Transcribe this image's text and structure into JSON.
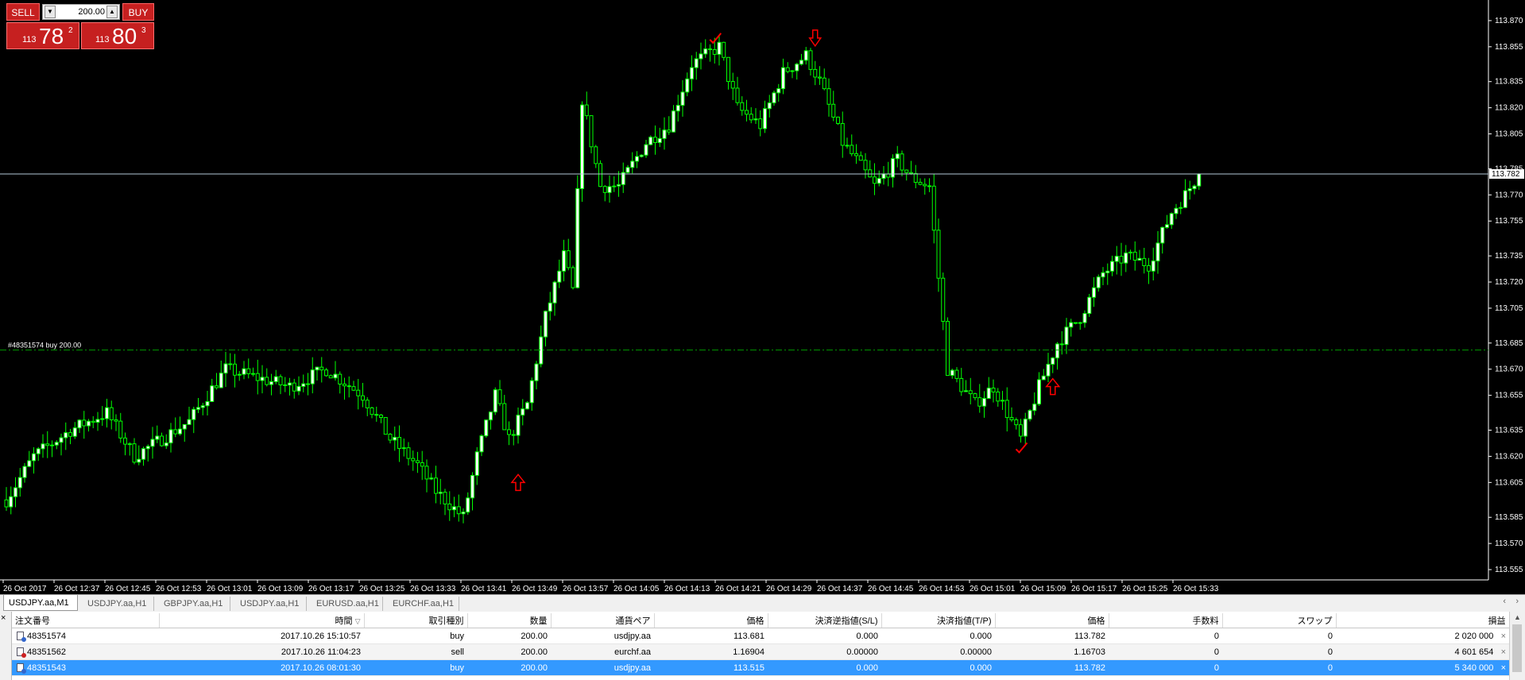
{
  "trade_panel": {
    "sell_label": "SELL",
    "buy_label": "BUY",
    "volume": "200.00",
    "down_symbol": "▼",
    "up_symbol": "▲",
    "bid": {
      "prefix": "113",
      "big": "78",
      "sup": "2"
    },
    "ask": {
      "prefix": "113",
      "big": "80",
      "sup": "3"
    }
  },
  "chart_data": {
    "type": "candlestick",
    "symbol": "USDJPY.aa",
    "timeframe": "M1",
    "y_ticks": [
      "113.870",
      "113.855",
      "113.835",
      "113.820",
      "113.805",
      "113.785",
      "113.770",
      "113.755",
      "113.735",
      "113.720",
      "113.705",
      "113.685",
      "113.670",
      "113.655",
      "113.635",
      "113.620",
      "113.605",
      "113.585",
      "113.570",
      "113.555"
    ],
    "ylim": [
      113.55,
      113.88
    ],
    "x_ticks": [
      "26 Oct 2017",
      "26 Oct 12:37",
      "26 Oct 12:45",
      "26 Oct 12:53",
      "26 Oct 13:01",
      "26 Oct 13:09",
      "26 Oct 13:17",
      "26 Oct 13:25",
      "26 Oct 13:33",
      "26 Oct 13:41",
      "26 Oct 13:49",
      "26 Oct 13:57",
      "26 Oct 14:05",
      "26 Oct 14:13",
      "26 Oct 14:21",
      "26 Oct 14:29",
      "26 Oct 14:37",
      "26 Oct 14:45",
      "26 Oct 14:53",
      "26 Oct 15:01",
      "26 Oct 15:09",
      "26 Oct 15:17",
      "26 Oct 15:25",
      "26 Oct 15:33"
    ],
    "current_price": 113.782,
    "current_price_label": "113.782",
    "position_line": {
      "price": 113.681,
      "label": "#48351574 buy 200.00"
    },
    "anchors": [
      {
        "t": 0,
        "p": 113.595
      },
      {
        "t": 6,
        "p": 113.62
      },
      {
        "t": 14,
        "p": 113.635
      },
      {
        "t": 22,
        "p": 113.645
      },
      {
        "t": 28,
        "p": 113.62
      },
      {
        "t": 34,
        "p": 113.63
      },
      {
        "t": 40,
        "p": 113.64
      },
      {
        "t": 48,
        "p": 113.67
      },
      {
        "t": 55,
        "p": 113.665
      },
      {
        "t": 62,
        "p": 113.66
      },
      {
        "t": 70,
        "p": 113.67
      },
      {
        "t": 78,
        "p": 113.655
      },
      {
        "t": 84,
        "p": 113.63
      },
      {
        "t": 90,
        "p": 113.615
      },
      {
        "t": 94,
        "p": 113.6
      },
      {
        "t": 100,
        "p": 113.585
      },
      {
        "t": 103,
        "p": 113.62
      },
      {
        "t": 107,
        "p": 113.655
      },
      {
        "t": 110,
        "p": 113.63
      },
      {
        "t": 114,
        "p": 113.65
      },
      {
        "t": 118,
        "p": 113.7
      },
      {
        "t": 122,
        "p": 113.735
      },
      {
        "t": 124,
        "p": 113.715
      },
      {
        "t": 126,
        "p": 113.825
      },
      {
        "t": 130,
        "p": 113.775
      },
      {
        "t": 134,
        "p": 113.775
      },
      {
        "t": 140,
        "p": 113.8
      },
      {
        "t": 145,
        "p": 113.81
      },
      {
        "t": 150,
        "p": 113.845
      },
      {
        "t": 156,
        "p": 113.855
      },
      {
        "t": 160,
        "p": 113.82
      },
      {
        "t": 165,
        "p": 113.81
      },
      {
        "t": 170,
        "p": 113.84
      },
      {
        "t": 175,
        "p": 113.85
      },
      {
        "t": 178,
        "p": 113.835
      },
      {
        "t": 183,
        "p": 113.8
      },
      {
        "t": 186,
        "p": 113.79
      },
      {
        "t": 190,
        "p": 113.775
      },
      {
        "t": 195,
        "p": 113.79
      },
      {
        "t": 198,
        "p": 113.78
      },
      {
        "t": 202,
        "p": 113.775
      },
      {
        "t": 206,
        "p": 113.67
      },
      {
        "t": 212,
        "p": 113.65
      },
      {
        "t": 216,
        "p": 113.66
      },
      {
        "t": 222,
        "p": 113.63
      },
      {
        "t": 226,
        "p": 113.66
      },
      {
        "t": 230,
        "p": 113.685
      },
      {
        "t": 235,
        "p": 113.7
      },
      {
        "t": 240,
        "p": 113.725
      },
      {
        "t": 245,
        "p": 113.735
      },
      {
        "t": 250,
        "p": 113.73
      },
      {
        "t": 255,
        "p": 113.76
      },
      {
        "t": 258,
        "p": 113.77
      },
      {
        "t": 261,
        "p": 113.782
      }
    ],
    "trade_arrows": [
      {
        "kind": "buy",
        "t": 112,
        "p": 113.605
      },
      {
        "kind": "close",
        "t": 155,
        "p": 113.86
      },
      {
        "kind": "sell",
        "t": 177,
        "p": 113.86
      },
      {
        "kind": "close",
        "t": 222,
        "p": 113.625
      },
      {
        "kind": "buy",
        "t": 229,
        "p": 113.66
      }
    ],
    "colors": {
      "bull": "#ffffff",
      "bear": "#000000",
      "wick": "#00ff00",
      "grid_line": "#b4c8d8",
      "arrow": "#ff0000",
      "position_line": "#009900"
    }
  },
  "tabs": [
    {
      "label": "USDJPY.aa,M1",
      "active": true
    },
    {
      "label": "USDJPY.aa,H1",
      "active": false
    },
    {
      "label": "GBPJPY.aa,H1",
      "active": false
    },
    {
      "label": "USDJPY.aa,H1",
      "active": false
    },
    {
      "label": "EURUSD.aa,H1",
      "active": false
    },
    {
      "label": "EURCHF.aa,H1",
      "active": false
    }
  ],
  "tab_scroll": {
    "left": "‹",
    "right": "›"
  },
  "terminal": {
    "close_symbol": "×",
    "sort_marker": "▽",
    "columns": [
      "注文番号",
      "時間",
      "取引種別",
      "数量",
      "通貨ペア",
      "価格",
      "決済逆指値(S/L)",
      "決済指値(T/P)",
      "価格",
      "手数料",
      "スワップ",
      "損益"
    ],
    "rows": [
      {
        "ticket": "48351574",
        "time": "2017.10.26 15:10:57",
        "type": "buy",
        "volume": "200.00",
        "symbol": "usdjpy.aa",
        "open_price": "113.681",
        "sl": "0.000",
        "tp": "0.000",
        "price": "113.782",
        "commission": "0",
        "swap": "0",
        "profit": "2 020 000",
        "close": "×",
        "icon_color": "#3366cc"
      },
      {
        "ticket": "48351562",
        "time": "2017.10.26 11:04:23",
        "type": "sell",
        "volume": "200.00",
        "symbol": "eurchf.aa",
        "open_price": "1.16904",
        "sl": "0.00000",
        "tp": "0.00000",
        "price": "1.16703",
        "commission": "0",
        "swap": "0",
        "profit": "4 601 654",
        "close": "×",
        "icon_color": "#cc2222"
      },
      {
        "ticket": "48351543",
        "time": "2017.10.26 08:01:30",
        "type": "buy",
        "volume": "200.00",
        "symbol": "usdjpy.aa",
        "open_price": "113.515",
        "sl": "0.000",
        "tp": "0.000",
        "price": "113.782",
        "commission": "0",
        "swap": "0",
        "profit": "5 340 000",
        "close": "×",
        "icon_color": "#3366cc"
      }
    ]
  }
}
